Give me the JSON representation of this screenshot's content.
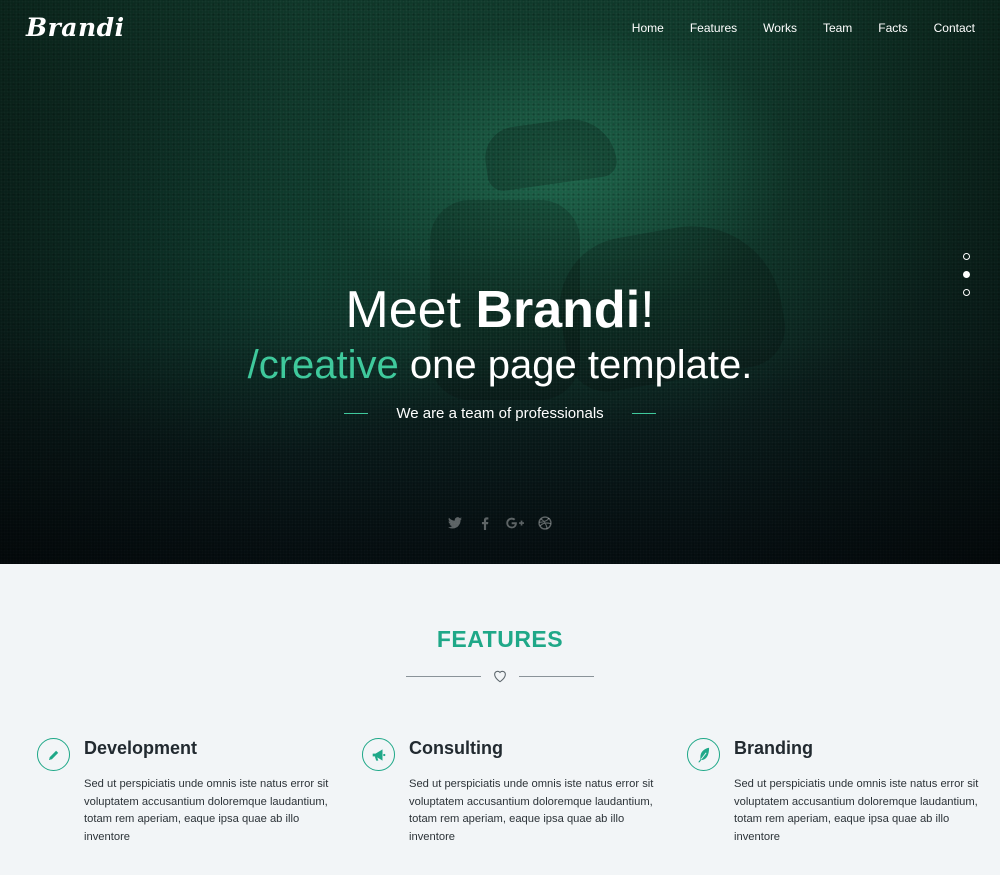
{
  "brand": {
    "logo": "Brandi"
  },
  "nav": {
    "items": [
      "Home",
      "Features",
      "Works",
      "Team",
      "Facts",
      "Contact"
    ]
  },
  "hero": {
    "title_prefix": "Meet ",
    "title_bold": "Brandi",
    "title_suffix": "!",
    "subtitle_accent": "/creative",
    "subtitle_rest": " one page template.",
    "tagline": "We are a team of professionals",
    "slides": {
      "count": 3,
      "active_index": 1
    },
    "socials": [
      "twitter-icon",
      "facebook-icon",
      "google-plus-icon",
      "dribbble-icon"
    ]
  },
  "features": {
    "title": "FEATURES",
    "items": [
      {
        "icon": "pencil-icon",
        "heading": "Development",
        "text": "Sed ut perspiciatis unde omnis iste natus error sit voluptatem accusantium doloremque laudantium, totam rem aperiam, eaque ipsa quae ab illo inventore"
      },
      {
        "icon": "megaphone-icon",
        "heading": "Consulting",
        "text": "Sed ut perspiciatis unde omnis iste natus error sit voluptatem accusantium doloremque laudantium, totam rem aperiam, eaque ipsa quae ab illo inventore"
      },
      {
        "icon": "feather-icon",
        "heading": "Branding",
        "text": "Sed ut perspiciatis unde omnis iste natus error sit voluptatem accusantium doloremque laudantium, totam rem aperiam, eaque ipsa quae ab illo inventore"
      }
    ]
  },
  "colors": {
    "accent": "#1fa888",
    "accent_light": "#3fc99c",
    "section_bg": "#f2f5f7"
  }
}
